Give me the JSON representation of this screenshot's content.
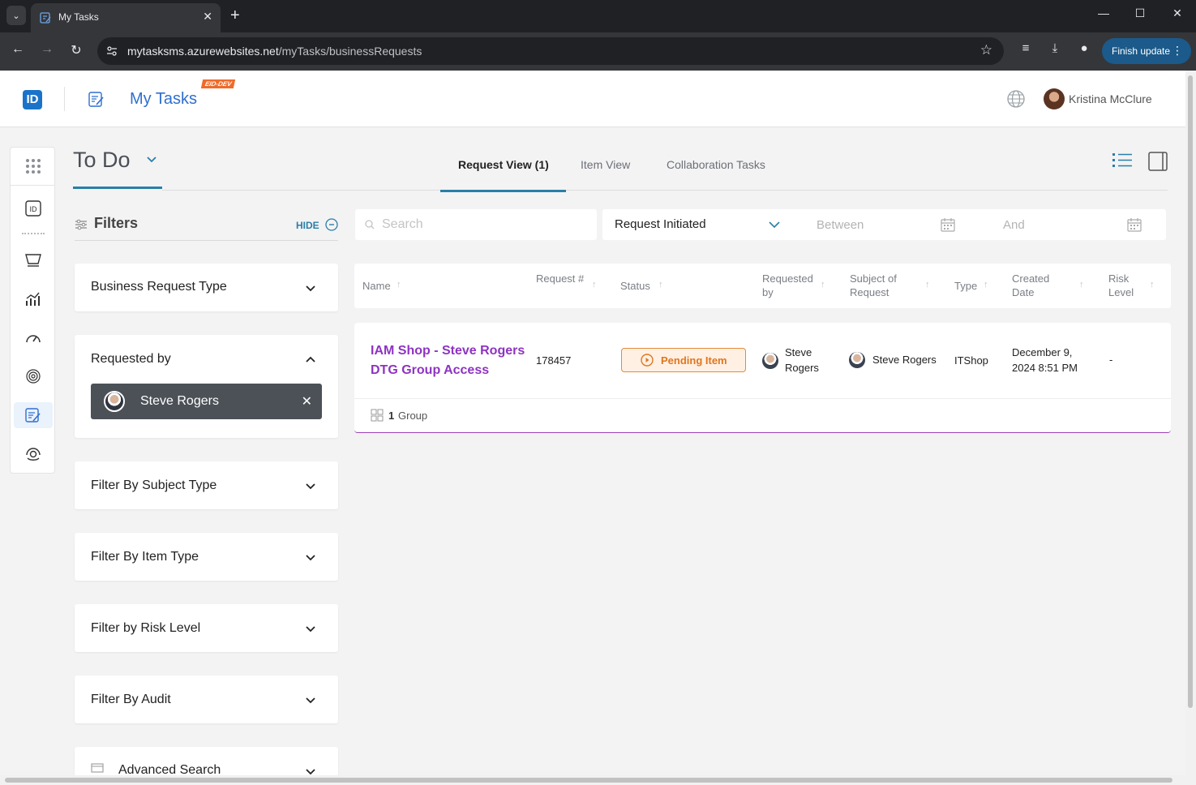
{
  "browser": {
    "tab_title": "My Tasks",
    "url_host": "mytasksms.azurewebsites.net",
    "url_path": "/myTasks/businessRequests",
    "finish_update": "Finish update"
  },
  "header": {
    "logo": "ID",
    "app_title": "My Tasks",
    "env_badge": "EID-DEV",
    "user_name": "Kristina McClure"
  },
  "page": {
    "title": "To Do",
    "tabs": [
      {
        "label": "Request View (1)"
      },
      {
        "label": "Item View"
      },
      {
        "label": "Collaboration Tasks"
      }
    ]
  },
  "filters": {
    "title": "Filters",
    "hide_label": "HIDE",
    "cards": [
      {
        "label": "Business Request Type"
      },
      {
        "label": "Requested by",
        "chip": "Steve Rogers"
      },
      {
        "label": "Filter By Subject Type"
      },
      {
        "label": "Filter By Item Type"
      },
      {
        "label": "Filter by Risk Level"
      },
      {
        "label": "Filter By Audit"
      },
      {
        "label": "Advanced Search"
      }
    ]
  },
  "search": {
    "placeholder": "Search"
  },
  "date_filter": {
    "selected": "Request Initiated",
    "between_label": "Between",
    "and_label": "And"
  },
  "table": {
    "columns": [
      {
        "label": "Name"
      },
      {
        "label": "Request #"
      },
      {
        "label": "Status"
      },
      {
        "label": "Requested by"
      },
      {
        "label": "Subject of Request"
      },
      {
        "label": "Type"
      },
      {
        "label": "Created Date"
      },
      {
        "label": "Risk Level"
      }
    ],
    "rows": [
      {
        "name_line1": "IAM Shop - Steve Rogers",
        "name_line2": "DTG Group Access",
        "request_number": "178457",
        "status": "Pending Item",
        "requested_by_line1": "Steve",
        "requested_by_line2": "Rogers",
        "subject": "Steve Rogers",
        "type": "ITShop",
        "created_line1": "December 9,",
        "created_line2": "2024 8:51 PM",
        "risk_level": "-",
        "group_count": "1",
        "group_label": "Group"
      }
    ]
  },
  "icons": [
    "apps-grid-icon",
    "id-icon",
    "cart-icon",
    "chart-icon",
    "gauge-icon",
    "fingerprint-icon",
    "tasks-icon",
    "support-icon",
    "globe-icon",
    "list-view-icon",
    "panel-icon",
    "calendar-icon",
    "search-icon",
    "chevron-down-icon",
    "close-icon"
  ],
  "colors": {
    "accent": "#2a7fa8",
    "brand_blue": "#1b73c9",
    "link_purple": "#8e33c2",
    "pending_orange": "#e0761f"
  }
}
